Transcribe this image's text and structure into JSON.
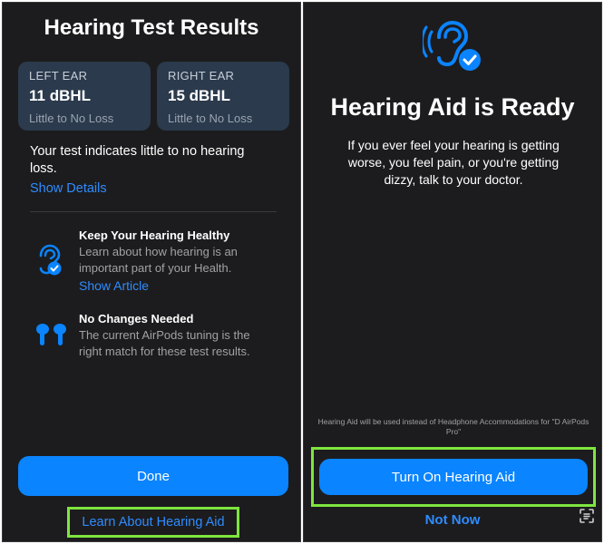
{
  "left": {
    "title": "Hearing Test Results",
    "left_ear": {
      "label": "LEFT EAR",
      "value": "11 dBHL",
      "status": "Little to No Loss"
    },
    "right_ear": {
      "label": "RIGHT EAR",
      "value": "15 dBHL",
      "status": "Little to No Loss"
    },
    "summary": "Your test indicates little to no hearing loss.",
    "show_details": "Show Details",
    "tips": [
      {
        "icon": "ear-check-icon",
        "title": "Keep Your Hearing Healthy",
        "body": "Learn about how hearing is an important part of your Health.",
        "link": "Show Article"
      },
      {
        "icon": "airpods-icon",
        "title": "No Changes Needed",
        "body": "The current AirPods tuning is the right match for these test results."
      }
    ],
    "done_label": "Done",
    "learn_label": "Learn About Hearing Aid"
  },
  "right": {
    "hero_icon": "hearing-aid-check-icon",
    "title": "Hearing Aid is Ready",
    "warning": "If you ever feel your hearing is getting worse, you feel pain, or you're getting dizzy, talk to your doctor.",
    "footnote": "Hearing Aid will be used instead of Headphone Accommodations for \"D AirPods Pro\"",
    "turn_on_label": "Turn On Hearing Aid",
    "not_now_label": "Not Now",
    "scan_icon": "live-text-scan-icon"
  },
  "colors": {
    "accent": "#0a84ff",
    "link": "#2f8cff",
    "highlight": "#7ee63e",
    "background": "#1c1c1e",
    "card": "#2b3a4c"
  }
}
